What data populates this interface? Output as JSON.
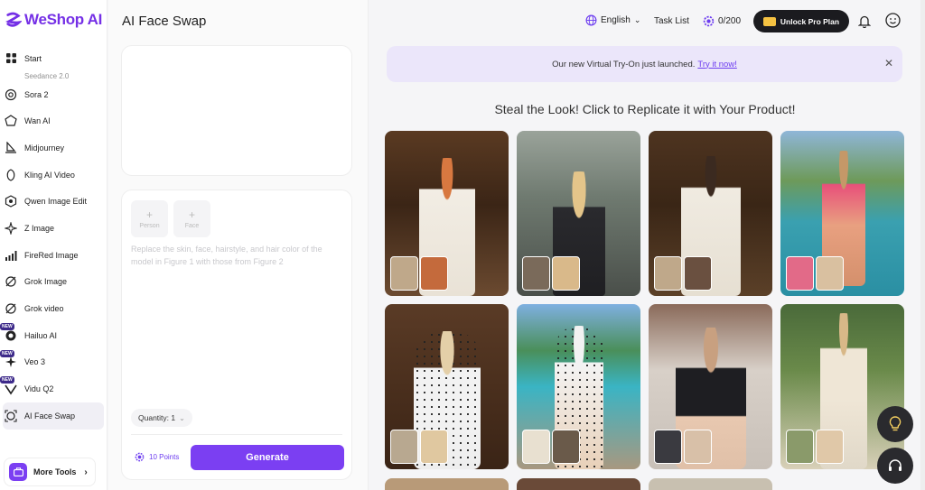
{
  "brand": {
    "name": "WeShop AI",
    "accent": "#7b3ff2"
  },
  "sidebar": {
    "items": [
      {
        "label": "Start",
        "icon": "grid-icon"
      },
      {
        "label": "Seedance 2.0",
        "icon": "seedance-icon"
      },
      {
        "label": "Sora 2",
        "icon": "sora-icon"
      },
      {
        "label": "Wan AI",
        "icon": "wan-icon"
      },
      {
        "label": "Midjourney",
        "icon": "sailboat-icon"
      },
      {
        "label": "Kling AI Video",
        "icon": "kling-icon"
      },
      {
        "label": "Qwen Image Edit",
        "icon": "qwen-icon"
      },
      {
        "label": "Z Image",
        "icon": "sparkle-icon"
      },
      {
        "label": "FireRed Image",
        "icon": "bars-icon"
      },
      {
        "label": "Grok Image",
        "icon": "grok-icon"
      },
      {
        "label": "Grok video",
        "icon": "grok-icon"
      },
      {
        "label": "Hailuo AI",
        "icon": "hailuo-icon",
        "badge": "NEW"
      },
      {
        "label": "Veo 3",
        "icon": "sparkle-icon",
        "badge": "NEW"
      },
      {
        "label": "Vidu Q2",
        "icon": "vidu-icon",
        "badge": "NEW"
      },
      {
        "label": "AI Face Swap",
        "icon": "face-swap-icon"
      }
    ],
    "more_tools": "More Tools"
  },
  "panel": {
    "title": "AI Face Swap",
    "slot_person": "Person",
    "slot_face": "Face",
    "prompt_placeholder": "Replace the skin, face, hairstyle, and hair color of the model in Figure 1 with those from Figure 2",
    "quantity": "Quantity: 1",
    "points": "10 Points",
    "generate": "Generate"
  },
  "topbar": {
    "language": "English",
    "task_list": "Task List",
    "credits": "0/200",
    "unlock": "Unlock Pro Plan"
  },
  "banner": {
    "text": "Our new Virtual Try-On just launched.",
    "link": "Try it now!"
  },
  "gallery": {
    "title": "Steal the Look! Click to Replicate it with Your Product!"
  }
}
